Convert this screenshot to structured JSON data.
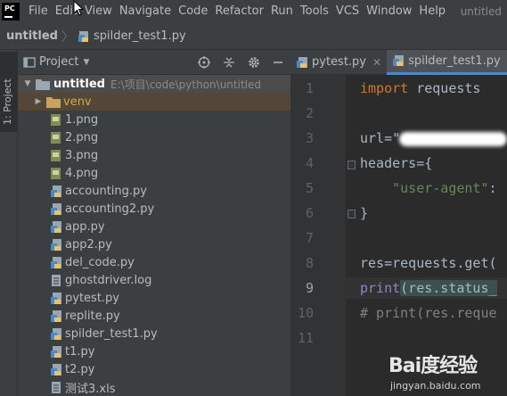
{
  "menubar": {
    "logo_text": "PC",
    "items": [
      "File",
      "Edit",
      "View",
      "Navigate",
      "Code",
      "Refactor",
      "Run",
      "Tools",
      "VCS",
      "Window",
      "Help"
    ],
    "window_title": "untitled"
  },
  "navbar": {
    "project": "untitled",
    "file": "spilder_test1.py"
  },
  "tool_stripe": {
    "label": "1: Project"
  },
  "project_panel": {
    "title": "Project",
    "root": {
      "name": "untitled",
      "path": "E:\\项目\\code\\python\\untitled"
    },
    "items": [
      {
        "name": "venv",
        "kind": "folder"
      },
      {
        "name": "1.png",
        "kind": "image"
      },
      {
        "name": "2.png",
        "kind": "image"
      },
      {
        "name": "3.png",
        "kind": "image"
      },
      {
        "name": "4.png",
        "kind": "image"
      },
      {
        "name": "accounting.py",
        "kind": "python"
      },
      {
        "name": "accounting2.py",
        "kind": "python"
      },
      {
        "name": "app.py",
        "kind": "python"
      },
      {
        "name": "app2.py",
        "kind": "python"
      },
      {
        "name": "del_code.py",
        "kind": "python"
      },
      {
        "name": "ghostdriver.log",
        "kind": "log"
      },
      {
        "name": "pytest.py",
        "kind": "python"
      },
      {
        "name": "replite.py",
        "kind": "python"
      },
      {
        "name": "spilder_test1.py",
        "kind": "python"
      },
      {
        "name": "t1.py",
        "kind": "python"
      },
      {
        "name": "t2.py",
        "kind": "python"
      },
      {
        "name": "测试3.xls",
        "kind": "excel"
      }
    ]
  },
  "editor": {
    "tabs": [
      {
        "label": "pytest.py",
        "active": false
      },
      {
        "label": "spilder_test1.py",
        "active": true
      }
    ],
    "line_numbers": [
      "1",
      "2",
      "3",
      "4",
      "5",
      "6",
      "7",
      "8",
      "9",
      "10",
      "11"
    ],
    "current_line": "9",
    "lines": {
      "l1_kw": "import",
      "l1_rest": " requests",
      "l3": "url=\"",
      "l4": "headers={",
      "l5_str": "    \"user-agent\"",
      "l5_rest": ":",
      "l6": "}",
      "l8": "res=requests.get(",
      "l9_builtin": "print",
      "l9_rest": "(res.status_",
      "l10": "# print(res.reque"
    }
  },
  "watermark": {
    "logo": "Bai度经验",
    "url": "jingyan.baidu.com"
  },
  "colors": {
    "menubar_bg": "#3c3f41",
    "editor_bg": "#2b2b2b",
    "gutter_bg": "#313335",
    "keyword": "#cc7832",
    "string": "#6a8759",
    "comment": "#808080",
    "builtin": "#8888c6",
    "tab_accent": "#4a88c7",
    "venv_highlight": "#544737"
  }
}
